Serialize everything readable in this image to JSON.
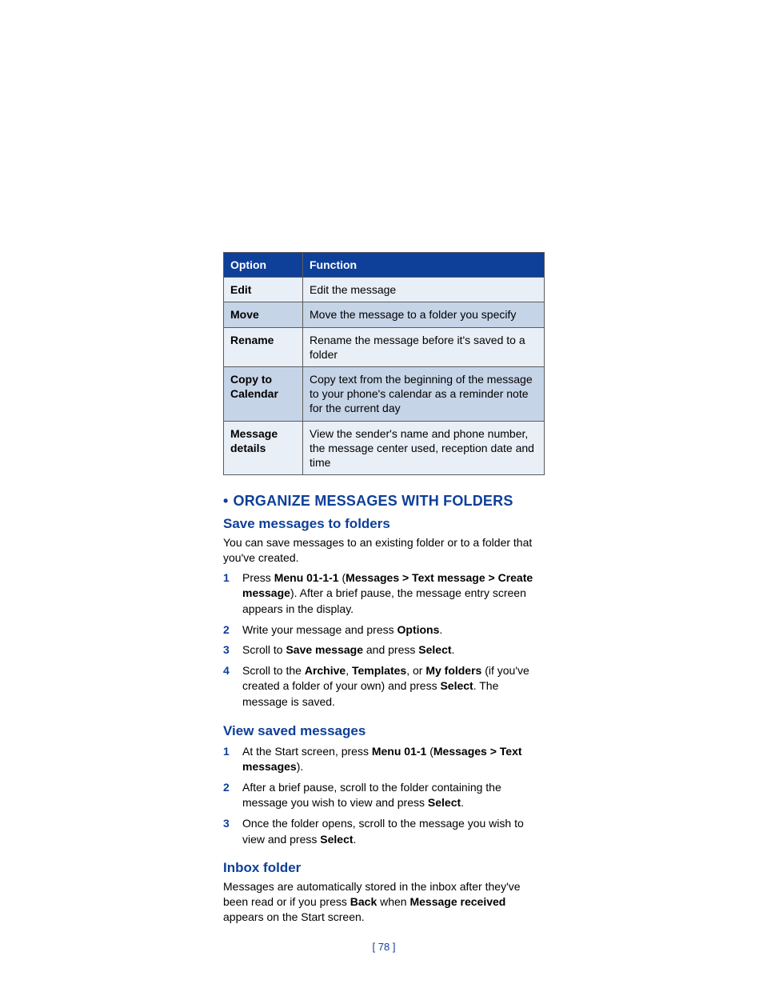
{
  "table": {
    "headers": {
      "option": "Option",
      "function": "Function"
    },
    "rows": [
      {
        "option": "Edit",
        "function": "Edit the message"
      },
      {
        "option": "Move",
        "function": "Move the message to a folder you specify"
      },
      {
        "option": "Rename",
        "function": "Rename the message before it's saved to a folder"
      },
      {
        "option": "Copy to Calendar",
        "function": "Copy text from the beginning of the message to your phone's calendar as a reminder note for the current day"
      },
      {
        "option": "Message details",
        "function": "View the sender's name and phone number, the message center used, reception date and time"
      }
    ]
  },
  "section1": {
    "title": "ORGANIZE MESSAGES WITH FOLDERS",
    "bullet": "•"
  },
  "save": {
    "heading": "Save messages to folders",
    "intro": "You can save messages to an existing folder or to a folder that you've created.",
    "steps": [
      {
        "n": "1",
        "parts": [
          "Press ",
          "Menu 01-1-1",
          " (",
          "Messages > Text message > Create message",
          "). After a brief pause, the message entry screen appears in the display."
        ]
      },
      {
        "n": "2",
        "parts": [
          "Write your message and press ",
          "Options",
          "."
        ]
      },
      {
        "n": "3",
        "parts": [
          "Scroll to ",
          "Save message",
          " and press ",
          "Select",
          "."
        ]
      },
      {
        "n": "4",
        "parts": [
          "Scroll to the ",
          "Archive",
          ", ",
          "Templates",
          ", or ",
          "My folders",
          " (if you've created a folder of your own) and press ",
          "Select",
          ". The message is saved."
        ]
      }
    ]
  },
  "view": {
    "heading": "View saved messages",
    "steps": [
      {
        "n": "1",
        "parts": [
          "At the Start screen, press ",
          "Menu 01-1",
          " (",
          "Messages > Text messages",
          ")."
        ]
      },
      {
        "n": "2",
        "parts": [
          "After a brief pause, scroll to the folder containing the message you wish to view and press ",
          "Select",
          "."
        ]
      },
      {
        "n": "3",
        "parts": [
          "Once the folder opens, scroll to the message you wish to view and press ",
          "Select",
          "."
        ]
      }
    ]
  },
  "inbox": {
    "heading": "Inbox folder",
    "parts": [
      "Messages are automatically stored in the inbox after they've been read or if you press ",
      "Back",
      " when ",
      "Message received",
      " appears on the Start screen."
    ]
  },
  "page_number": "[ 78 ]"
}
